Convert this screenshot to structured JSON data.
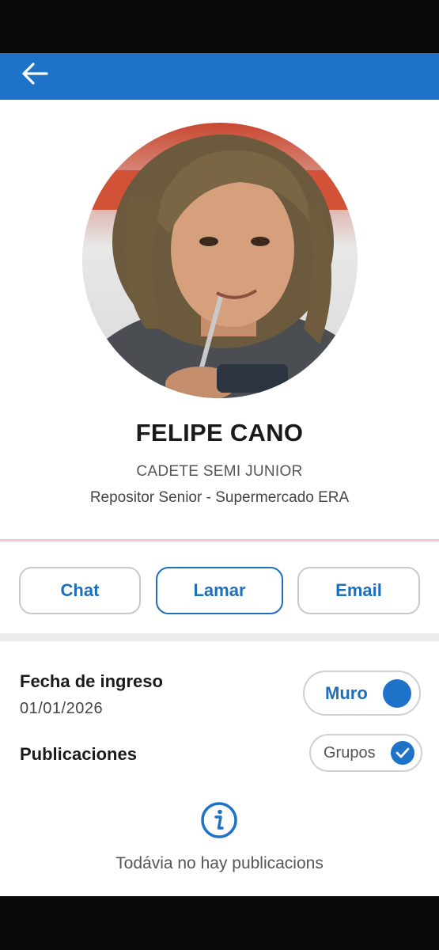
{
  "header": {
    "back_icon": "arrow-left-icon",
    "color": "#1e73c8"
  },
  "profile": {
    "name": "FELIPE CANO",
    "role": "CADETE SEMI JUNIOR",
    "position": "Repositor Senior - Supermercado ERA"
  },
  "actions": [
    {
      "label": "Chat",
      "active": false
    },
    {
      "label": "Lamar",
      "active": true
    },
    {
      "label": "Email",
      "active": false
    }
  ],
  "details": {
    "entry_date_label": "Fecha de ingreso",
    "entry_date_value": "01/01/2026",
    "publications_label": "Publicaciones"
  },
  "filters": {
    "muro_label": "Muro",
    "muro_selected": true,
    "grupos_label": "Grupos",
    "grupos_checked": true
  },
  "empty_state": {
    "icon": "info-icon",
    "message": "Todávia no hay publicacions"
  },
  "colors": {
    "accent": "#1e73c8",
    "button_text": "#1f6fb8",
    "divider": "#f0c7cc"
  }
}
